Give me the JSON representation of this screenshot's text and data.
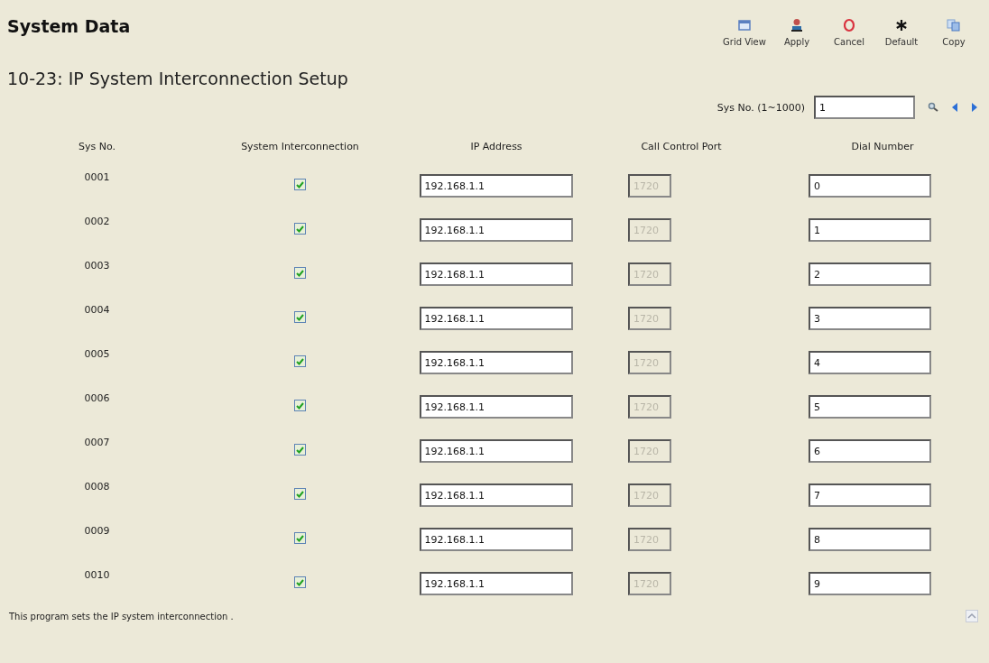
{
  "header": {
    "title": "System Data"
  },
  "toolbar": [
    {
      "label": "Grid View"
    },
    {
      "label": "Apply"
    },
    {
      "label": "Cancel"
    },
    {
      "label": "Default"
    },
    {
      "label": "Copy"
    }
  ],
  "page_title": "10-23: IP System Interconnection Setup",
  "search": {
    "label": "Sys No. (1~1000)",
    "value": "1"
  },
  "table": {
    "columns": [
      "Sys No.",
      "System Interconnection",
      "IP Address",
      "Call Control Port",
      "Dial Number"
    ],
    "rows": [
      {
        "sys_no": "0001",
        "interconnection": true,
        "ip": "192.168.1.1",
        "port": "1720",
        "port_disabled": true,
        "dial": "0"
      },
      {
        "sys_no": "0002",
        "interconnection": true,
        "ip": "192.168.1.1",
        "port": "1720",
        "port_disabled": true,
        "dial": "1"
      },
      {
        "sys_no": "0003",
        "interconnection": true,
        "ip": "192.168.1.1",
        "port": "1720",
        "port_disabled": true,
        "dial": "2"
      },
      {
        "sys_no": "0004",
        "interconnection": true,
        "ip": "192.168.1.1",
        "port": "1720",
        "port_disabled": true,
        "dial": "3"
      },
      {
        "sys_no": "0005",
        "interconnection": true,
        "ip": "192.168.1.1",
        "port": "1720",
        "port_disabled": true,
        "dial": "4"
      },
      {
        "sys_no": "0006",
        "interconnection": true,
        "ip": "192.168.1.1",
        "port": "1720",
        "port_disabled": true,
        "dial": "5"
      },
      {
        "sys_no": "0007",
        "interconnection": true,
        "ip": "192.168.1.1",
        "port": "1720",
        "port_disabled": true,
        "dial": "6"
      },
      {
        "sys_no": "0008",
        "interconnection": true,
        "ip": "192.168.1.1",
        "port": "1720",
        "port_disabled": true,
        "dial": "7"
      },
      {
        "sys_no": "0009",
        "interconnection": true,
        "ip": "192.168.1.1",
        "port": "1720",
        "port_disabled": true,
        "dial": "8"
      },
      {
        "sys_no": "0010",
        "interconnection": true,
        "ip": "192.168.1.1",
        "port": "1720",
        "port_disabled": true,
        "dial": "9"
      }
    ]
  },
  "status_bar": {
    "text": "This program sets the IP system interconnection ."
  }
}
